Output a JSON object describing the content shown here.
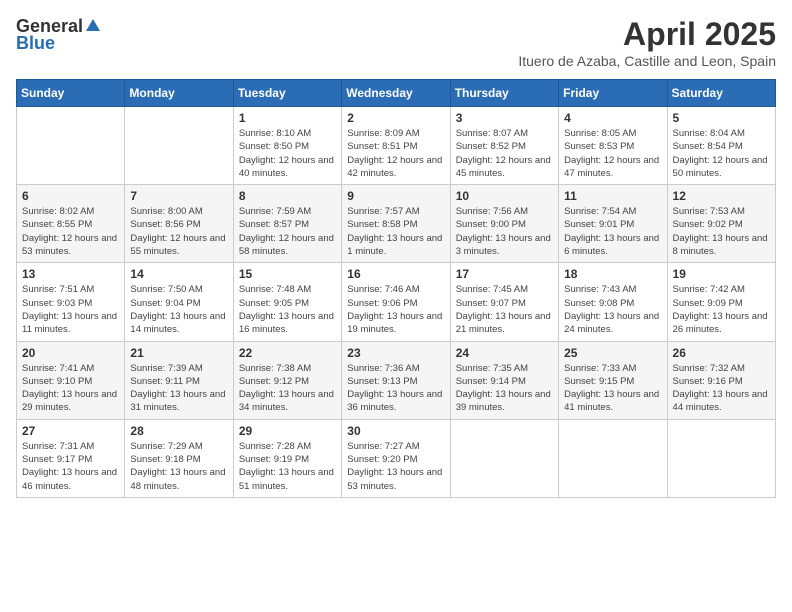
{
  "header": {
    "logo_general": "General",
    "logo_blue": "Blue",
    "month_title": "April 2025",
    "location": "Ituero de Azaba, Castille and Leon, Spain"
  },
  "days_of_week": [
    "Sunday",
    "Monday",
    "Tuesday",
    "Wednesday",
    "Thursday",
    "Friday",
    "Saturday"
  ],
  "weeks": [
    [
      {
        "day": "",
        "info": ""
      },
      {
        "day": "",
        "info": ""
      },
      {
        "day": "1",
        "info": "Sunrise: 8:10 AM\nSunset: 8:50 PM\nDaylight: 12 hours and 40 minutes."
      },
      {
        "day": "2",
        "info": "Sunrise: 8:09 AM\nSunset: 8:51 PM\nDaylight: 12 hours and 42 minutes."
      },
      {
        "day": "3",
        "info": "Sunrise: 8:07 AM\nSunset: 8:52 PM\nDaylight: 12 hours and 45 minutes."
      },
      {
        "day": "4",
        "info": "Sunrise: 8:05 AM\nSunset: 8:53 PM\nDaylight: 12 hours and 47 minutes."
      },
      {
        "day": "5",
        "info": "Sunrise: 8:04 AM\nSunset: 8:54 PM\nDaylight: 12 hours and 50 minutes."
      }
    ],
    [
      {
        "day": "6",
        "info": "Sunrise: 8:02 AM\nSunset: 8:55 PM\nDaylight: 12 hours and 53 minutes."
      },
      {
        "day": "7",
        "info": "Sunrise: 8:00 AM\nSunset: 8:56 PM\nDaylight: 12 hours and 55 minutes."
      },
      {
        "day": "8",
        "info": "Sunrise: 7:59 AM\nSunset: 8:57 PM\nDaylight: 12 hours and 58 minutes."
      },
      {
        "day": "9",
        "info": "Sunrise: 7:57 AM\nSunset: 8:58 PM\nDaylight: 13 hours and 1 minute."
      },
      {
        "day": "10",
        "info": "Sunrise: 7:56 AM\nSunset: 9:00 PM\nDaylight: 13 hours and 3 minutes."
      },
      {
        "day": "11",
        "info": "Sunrise: 7:54 AM\nSunset: 9:01 PM\nDaylight: 13 hours and 6 minutes."
      },
      {
        "day": "12",
        "info": "Sunrise: 7:53 AM\nSunset: 9:02 PM\nDaylight: 13 hours and 8 minutes."
      }
    ],
    [
      {
        "day": "13",
        "info": "Sunrise: 7:51 AM\nSunset: 9:03 PM\nDaylight: 13 hours and 11 minutes."
      },
      {
        "day": "14",
        "info": "Sunrise: 7:50 AM\nSunset: 9:04 PM\nDaylight: 13 hours and 14 minutes."
      },
      {
        "day": "15",
        "info": "Sunrise: 7:48 AM\nSunset: 9:05 PM\nDaylight: 13 hours and 16 minutes."
      },
      {
        "day": "16",
        "info": "Sunrise: 7:46 AM\nSunset: 9:06 PM\nDaylight: 13 hours and 19 minutes."
      },
      {
        "day": "17",
        "info": "Sunrise: 7:45 AM\nSunset: 9:07 PM\nDaylight: 13 hours and 21 minutes."
      },
      {
        "day": "18",
        "info": "Sunrise: 7:43 AM\nSunset: 9:08 PM\nDaylight: 13 hours and 24 minutes."
      },
      {
        "day": "19",
        "info": "Sunrise: 7:42 AM\nSunset: 9:09 PM\nDaylight: 13 hours and 26 minutes."
      }
    ],
    [
      {
        "day": "20",
        "info": "Sunrise: 7:41 AM\nSunset: 9:10 PM\nDaylight: 13 hours and 29 minutes."
      },
      {
        "day": "21",
        "info": "Sunrise: 7:39 AM\nSunset: 9:11 PM\nDaylight: 13 hours and 31 minutes."
      },
      {
        "day": "22",
        "info": "Sunrise: 7:38 AM\nSunset: 9:12 PM\nDaylight: 13 hours and 34 minutes."
      },
      {
        "day": "23",
        "info": "Sunrise: 7:36 AM\nSunset: 9:13 PM\nDaylight: 13 hours and 36 minutes."
      },
      {
        "day": "24",
        "info": "Sunrise: 7:35 AM\nSunset: 9:14 PM\nDaylight: 13 hours and 39 minutes."
      },
      {
        "day": "25",
        "info": "Sunrise: 7:33 AM\nSunset: 9:15 PM\nDaylight: 13 hours and 41 minutes."
      },
      {
        "day": "26",
        "info": "Sunrise: 7:32 AM\nSunset: 9:16 PM\nDaylight: 13 hours and 44 minutes."
      }
    ],
    [
      {
        "day": "27",
        "info": "Sunrise: 7:31 AM\nSunset: 9:17 PM\nDaylight: 13 hours and 46 minutes."
      },
      {
        "day": "28",
        "info": "Sunrise: 7:29 AM\nSunset: 9:18 PM\nDaylight: 13 hours and 48 minutes."
      },
      {
        "day": "29",
        "info": "Sunrise: 7:28 AM\nSunset: 9:19 PM\nDaylight: 13 hours and 51 minutes."
      },
      {
        "day": "30",
        "info": "Sunrise: 7:27 AM\nSunset: 9:20 PM\nDaylight: 13 hours and 53 minutes."
      },
      {
        "day": "",
        "info": ""
      },
      {
        "day": "",
        "info": ""
      },
      {
        "day": "",
        "info": ""
      }
    ]
  ]
}
